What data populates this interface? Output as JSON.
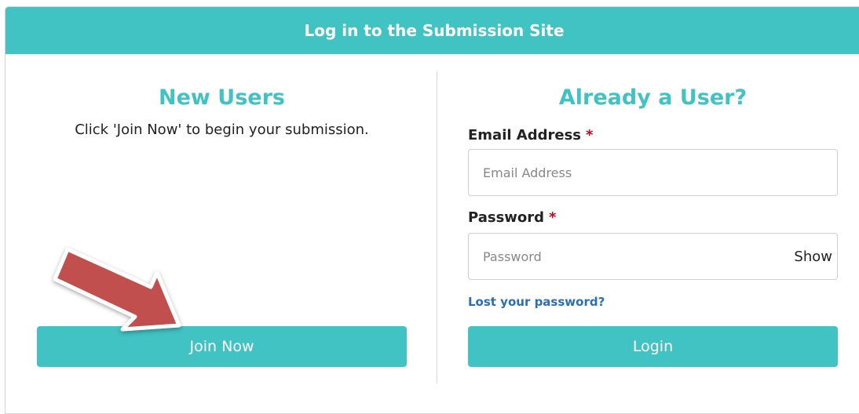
{
  "header": {
    "title": "Log in to the Submission Site"
  },
  "new_users": {
    "title": "New Users",
    "description": "Click 'Join Now' to begin your submission.",
    "join_label": "Join Now"
  },
  "existing_users": {
    "title": "Already a User?",
    "email_label": "Email Address",
    "email_placeholder": "Email Address",
    "password_label": "Password",
    "password_placeholder": "Password",
    "required_mark": "*",
    "show_label": "Show",
    "lost_password": "Lost your password?",
    "login_label": "Login"
  },
  "colors": {
    "accent": "#41c2c3",
    "link": "#2a6fb0",
    "required": "#d0021b",
    "arrow": "#c0504d"
  },
  "annotation": {
    "icon": "arrow-icon"
  }
}
